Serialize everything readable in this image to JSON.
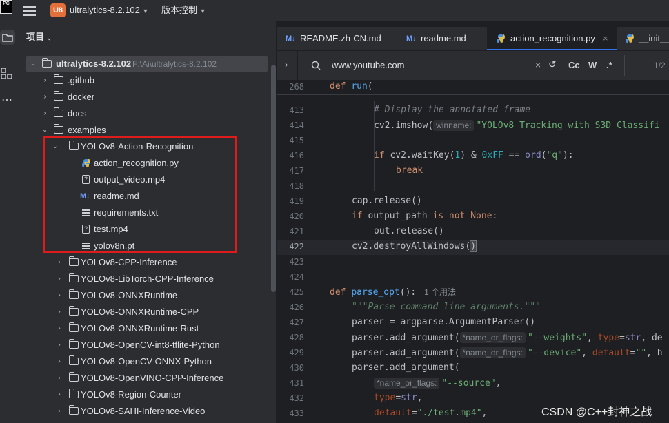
{
  "app": {
    "logo_text": "PC",
    "badge": "U8",
    "project_name": "ultralytics-8.2.102",
    "vcs_menu": "版本控制"
  },
  "panel": {
    "title": "项目"
  },
  "tree": {
    "root_name": "ultralytics-8.2.102",
    "root_path": "F:\\Ai\\ultralytics-8.2.102",
    "items": [
      {
        "label": ".github"
      },
      {
        "label": "docker"
      },
      {
        "label": "docs"
      },
      {
        "label": "examples"
      },
      {
        "label": "YOLOv8-Action-Recognition"
      },
      {
        "label": "action_recognition.py"
      },
      {
        "label": "output_video.mp4"
      },
      {
        "label": "readme.md"
      },
      {
        "label": "requirements.txt"
      },
      {
        "label": "test.mp4"
      },
      {
        "label": "yolov8n.pt"
      },
      {
        "label": "YOLOv8-CPP-Inference"
      },
      {
        "label": "YOLOv8-LibTorch-CPP-Inference"
      },
      {
        "label": "YOLOv8-ONNXRuntime"
      },
      {
        "label": "YOLOv8-ONNXRuntime-CPP"
      },
      {
        "label": "YOLOv8-ONNXRuntime-Rust"
      },
      {
        "label": "YOLOv8-OpenCV-int8-tflite-Python"
      },
      {
        "label": "YOLOv8-OpenCV-ONNX-Python"
      },
      {
        "label": "YOLOv8-OpenVINO-CPP-Inference"
      },
      {
        "label": "YOLOv8-Region-Counter"
      },
      {
        "label": "YOLOv8-SAHI-Inference-Video"
      }
    ]
  },
  "tabs": [
    {
      "icon": "M↓",
      "label": "README.zh-CN.md"
    },
    {
      "icon": "M↓",
      "label": "readme.md"
    },
    {
      "icon": "python",
      "label": "action_recognition.py",
      "close": "×"
    },
    {
      "icon": "python",
      "label": "__init__.p"
    }
  ],
  "find": {
    "query": "www.youtube.com",
    "match_case": "Cc",
    "words": "W",
    "regex": ".*",
    "count": "1/2"
  },
  "editor": {
    "line_numbers": [
      "268",
      "413",
      "414",
      "415",
      "416",
      "417",
      "418",
      "419",
      "420",
      "421",
      "422",
      "423",
      "424",
      "425",
      "426",
      "427",
      "428",
      "429",
      "430",
      "431",
      "432",
      "433"
    ],
    "hints": {
      "winname": "winname:",
      "usages": "1 个用法",
      "flags": "*name_or_flags:"
    },
    "code": {
      "l268a": "def ",
      "l268b": "run",
      "l268c": "(",
      "l413": "# Display the annotated frame",
      "l414a": "cv2.imshow(",
      "l414b": "\"YOLOv8 Tracking with S3D Classifi",
      "l416a": "if ",
      "l416b": "cv2.waitKey(",
      "l416c": "1",
      "l416d": ") & ",
      "l416e": "0xFF",
      "l416f": " == ",
      "l416g": "ord",
      "l416h": "(",
      "l416i": "\"q\"",
      "l416j": "):",
      "l417": "break",
      "l419": "cap.release()",
      "l420a": "if ",
      "l420b": "output_path ",
      "l420c": "is not None",
      "l420d": ":",
      "l421": "out.release()",
      "l422a": "cv2.destroyAllWindows(",
      "l422b": ")",
      "l425a": "def ",
      "l425b": "parse_opt",
      "l425c": "():",
      "l426": "\"\"\"Parse command line arguments.\"\"\"",
      "l427": "parser = argparse.ArgumentParser()",
      "l428a": "parser.add_argument(",
      "l428b": "\"--weights\"",
      "l428c": ", ",
      "l428d": "type",
      "l428e": "=",
      "l428f": "str",
      "l428g": ", de",
      "l429a": "parser.add_argument(",
      "l429b": "\"--device\"",
      "l429c": ", ",
      "l429d": "default",
      "l429e": "=",
      "l429f": "\"\"",
      "l429g": ", h",
      "l430": "parser.add_argument(",
      "l431": "\"--source\"",
      "l431b": ",",
      "l432a": "type",
      "l432b": "=",
      "l432c": "str",
      "l432d": ",",
      "l433a": "default",
      "l433b": "=",
      "l433c": "\"./test.mp4\"",
      "l433d": ","
    }
  },
  "watermark": "CSDN @C++封神之战"
}
